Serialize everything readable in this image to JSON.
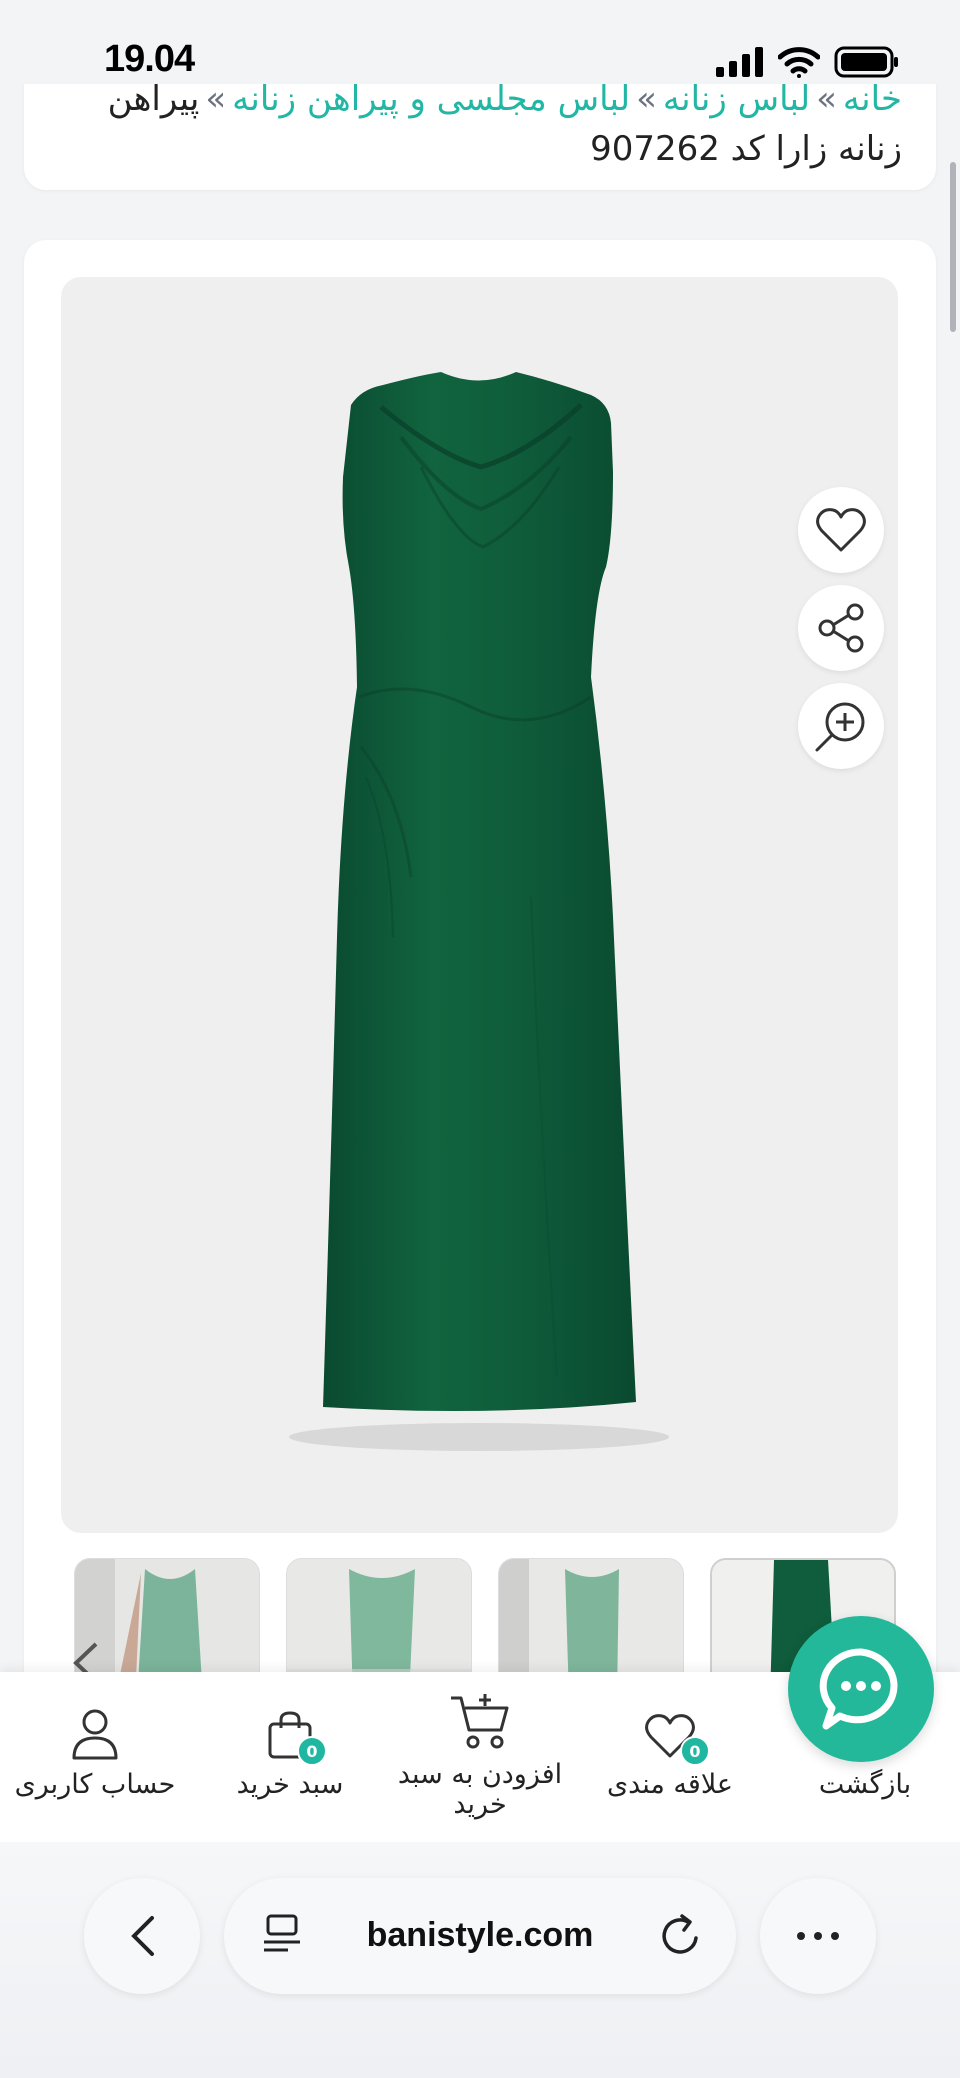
{
  "status": {
    "time": "19.04"
  },
  "breadcrumb": {
    "items": [
      "خانه",
      "لباس زنانه",
      "لباس مجلسی و پیراهن زنانه"
    ],
    "separator": "»",
    "current": "پیراهن زنانه زارا کد 907262"
  },
  "product": {
    "dress_color": "#0f5d3d",
    "actions": {
      "wishlist_icon": "heart-icon",
      "share_icon": "share-icon",
      "zoom_icon": "zoom-in-icon"
    }
  },
  "bottom_nav": {
    "back": {
      "label": "بازگشت"
    },
    "wishlist": {
      "label": "علاقه مندی",
      "badge": "0"
    },
    "add_to_cart": {
      "label": "افزودن به سبد خرید"
    },
    "cart": {
      "label": "سبد خرید",
      "badge": "0"
    },
    "account": {
      "label": "حساب کاربری"
    }
  },
  "browser": {
    "url": "banistyle.com"
  },
  "colors": {
    "accent": "#22b7a5",
    "chat": "#24b89a"
  }
}
